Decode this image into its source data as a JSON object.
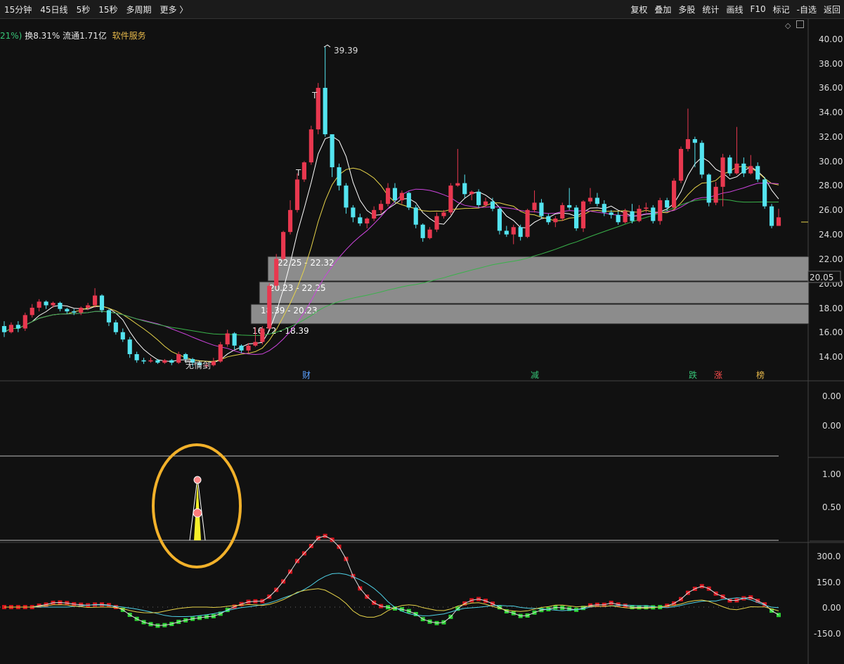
{
  "toolbar": {
    "left": [
      "15分钟",
      "45日线",
      "5秒",
      "15秒",
      "多周期",
      "更多 〉"
    ],
    "right": [
      "复权",
      "叠加",
      "多股",
      "统计",
      "画线",
      "F10",
      "标记",
      "-自选",
      "返回"
    ]
  },
  "info": {
    "pct": "21%)",
    "turnover": "换8.31% 流通1.71亿",
    "service": "软件服务"
  },
  "price_axis": {
    "ticks": [
      "40.00",
      "38.00",
      "36.00",
      "34.00",
      "32.00",
      "30.00",
      "28.00",
      "26.00",
      "24.00",
      "22.00",
      "20.00",
      "18.00",
      "16.00",
      "14.00"
    ],
    "current_price": "20.05"
  },
  "annotations": {
    "high": "39.39",
    "sword": "无情剑",
    "zones": [
      "22.25 - 22.32",
      "20.23 - 22.25",
      "18.39 - 20.23",
      "16.72 - 18.39"
    ]
  },
  "event_marks": [
    {
      "label": "财",
      "color": "#5aa0ff"
    },
    {
      "label": "减",
      "color": "#36c476"
    },
    {
      "label": "跌",
      "color": "#36c476"
    },
    {
      "label": "涨",
      "color": "#ff4d4d"
    },
    {
      "label": "榜",
      "color": "#e6b84a"
    }
  ],
  "panel2": {
    "ticks": [
      "0.00",
      "0.00"
    ]
  },
  "panel3": {
    "ticks": [
      "1.00",
      "0.50"
    ]
  },
  "panel4": {
    "ticks": [
      "300.0",
      "150.0",
      "0.00",
      "-150.0"
    ]
  },
  "colors": {
    "up": "#e8384f",
    "down": "#54e4f0",
    "ma5": "#ffffff",
    "ma10": "#e6d34a",
    "ma20": "#cc44dd",
    "ma60": "#39b24a",
    "highlight": "#f2b12a"
  },
  "chart_data": {
    "type": "candlestick",
    "x_period": "15分钟",
    "candles": [
      [
        16.5,
        16.0,
        16.9,
        15.6
      ],
      [
        16.0,
        16.6,
        16.8,
        15.9
      ],
      [
        16.6,
        16.3,
        16.9,
        16.0
      ],
      [
        16.3,
        17.4,
        17.6,
        16.1
      ],
      [
        17.4,
        18.0,
        18.3,
        17.2
      ],
      [
        18.0,
        18.5,
        18.7,
        17.7
      ],
      [
        18.5,
        18.2,
        18.6,
        17.9
      ],
      [
        18.2,
        18.4,
        18.5,
        18.0
      ],
      [
        18.4,
        17.9,
        18.5,
        17.7
      ],
      [
        17.9,
        17.7,
        18.0,
        17.5
      ],
      [
        17.7,
        17.6,
        17.9,
        17.4
      ],
      [
        17.6,
        18.0,
        18.1,
        17.4
      ],
      [
        18.0,
        18.2,
        18.4,
        17.8
      ],
      [
        18.2,
        19.0,
        19.6,
        18.0
      ],
      [
        19.0,
        17.8,
        19.1,
        17.6
      ],
      [
        17.8,
        16.8,
        17.9,
        16.5
      ],
      [
        16.8,
        16.0,
        17.0,
        15.8
      ],
      [
        16.0,
        15.4,
        16.3,
        15.2
      ],
      [
        15.4,
        14.2,
        15.6,
        13.9
      ],
      [
        14.2,
        13.7,
        14.4,
        13.5
      ],
      [
        13.7,
        13.6,
        13.9,
        13.4
      ],
      [
        13.6,
        13.7,
        13.9,
        13.5
      ],
      [
        13.7,
        13.5,
        13.8,
        13.4
      ],
      [
        13.5,
        13.7,
        13.8,
        13.4
      ],
      [
        13.7,
        13.5,
        13.8,
        13.3
      ],
      [
        13.5,
        14.2,
        14.4,
        13.4
      ],
      [
        14.2,
        13.8,
        14.3,
        13.5
      ],
      [
        13.8,
        13.5,
        13.9,
        13.2
      ],
      [
        13.5,
        13.3,
        13.6,
        13.1
      ],
      [
        13.3,
        13.3,
        13.5,
        13.1
      ],
      [
        13.3,
        13.6,
        13.9,
        13.2
      ],
      [
        13.6,
        15.0,
        15.2,
        13.5
      ],
      [
        15.0,
        15.9,
        16.2,
        14.8
      ],
      [
        15.9,
        14.9,
        16.0,
        14.6
      ],
      [
        14.9,
        14.5,
        15.0,
        14.3
      ],
      [
        14.5,
        14.9,
        15.1,
        14.3
      ],
      [
        14.9,
        15.2,
        16.4,
        14.8
      ],
      [
        15.2,
        16.3,
        16.5,
        15.0
      ],
      [
        16.3,
        19.8,
        20.0,
        16.2
      ],
      [
        19.8,
        22.0,
        22.4,
        19.5
      ],
      [
        22.0,
        24.2,
        24.3,
        21.9
      ],
      [
        24.2,
        26.0,
        26.8,
        24.0
      ],
      [
        26.0,
        28.5,
        29.0,
        25.8
      ],
      [
        28.5,
        29.9,
        30.0,
        28.3
      ],
      [
        29.9,
        32.6,
        32.9,
        29.7
      ],
      [
        32.6,
        36.0,
        36.4,
        32.2
      ],
      [
        36.0,
        32.2,
        39.39,
        32.0
      ],
      [
        32.2,
        29.5,
        31.1,
        28.7
      ],
      [
        29.5,
        28.0,
        29.8,
        27.6
      ],
      [
        28.0,
        26.2,
        28.2,
        25.7
      ],
      [
        26.2,
        25.4,
        26.4,
        25.0
      ],
      [
        25.4,
        24.9,
        25.7,
        24.7
      ],
      [
        24.9,
        25.3,
        25.4,
        24.5
      ],
      [
        25.3,
        26.0,
        26.3,
        25.1
      ],
      [
        26.0,
        26.5,
        26.8,
        25.7
      ],
      [
        26.5,
        27.8,
        28.2,
        26.3
      ],
      [
        27.8,
        26.8,
        28.2,
        26.6
      ],
      [
        26.8,
        27.4,
        27.6,
        26.5
      ],
      [
        27.4,
        26.2,
        27.5,
        26.0
      ],
      [
        26.2,
        24.8,
        26.4,
        24.5
      ],
      [
        24.8,
        23.7,
        24.9,
        23.4
      ],
      [
        23.7,
        24.4,
        24.6,
        23.6
      ],
      [
        24.4,
        25.5,
        25.8,
        24.2
      ],
      [
        25.5,
        25.8,
        26.0,
        25.3
      ],
      [
        25.8,
        28.0,
        28.2,
        25.6
      ],
      [
        28.0,
        28.2,
        31.0,
        27.9
      ],
      [
        28.2,
        27.3,
        28.9,
        27.0
      ],
      [
        27.3,
        27.5,
        27.6,
        26.8
      ],
      [
        27.5,
        26.4,
        27.7,
        26.2
      ],
      [
        26.4,
        26.7,
        27.0,
        26.2
      ],
      [
        26.7,
        26.1,
        27.0,
        25.9
      ],
      [
        26.1,
        24.3,
        26.2,
        24.0
      ],
      [
        24.3,
        24.0,
        24.7,
        23.8
      ],
      [
        24.0,
        24.6,
        24.8,
        23.2
      ],
      [
        24.6,
        23.8,
        24.8,
        23.5
      ],
      [
        23.8,
        26.0,
        26.1,
        23.7
      ],
      [
        26.0,
        26.6,
        27.6,
        25.8
      ],
      [
        26.6,
        25.5,
        26.9,
        25.3
      ],
      [
        25.5,
        25.0,
        25.7,
        24.8
      ],
      [
        25.0,
        25.3,
        25.5,
        24.6
      ],
      [
        25.3,
        26.4,
        26.6,
        25.1
      ],
      [
        26.4,
        26.2,
        27.8,
        26.0
      ],
      [
        26.2,
        24.5,
        26.4,
        24.3
      ],
      [
        24.5,
        26.7,
        26.8,
        24.2
      ],
      [
        26.7,
        27.0,
        27.8,
        26.5
      ],
      [
        27.0,
        26.5,
        27.4,
        26.3
      ],
      [
        26.5,
        25.8,
        26.8,
        25.5
      ],
      [
        25.8,
        25.6,
        26.0,
        25.3
      ],
      [
        25.6,
        25.0,
        25.9,
        24.8
      ],
      [
        25.0,
        25.9,
        26.1,
        24.9
      ],
      [
        25.9,
        25.1,
        26.5,
        24.9
      ],
      [
        25.1,
        26.1,
        26.4,
        25.0
      ],
      [
        26.1,
        26.2,
        26.6,
        25.8
      ],
      [
        26.2,
        25.1,
        26.4,
        24.9
      ],
      [
        25.1,
        26.8,
        27.0,
        24.8
      ],
      [
        26.8,
        26.2,
        27.0,
        25.9
      ],
      [
        26.2,
        28.4,
        28.6,
        26.0
      ],
      [
        28.4,
        31.0,
        31.2,
        28.2
      ],
      [
        31.0,
        31.8,
        34.3,
        30.8
      ],
      [
        31.8,
        31.5,
        32.0,
        29.5
      ],
      [
        31.5,
        28.9,
        31.7,
        28.6
      ],
      [
        28.9,
        26.6,
        29.0,
        26.3
      ],
      [
        26.6,
        27.9,
        28.3,
        26.4
      ],
      [
        27.9,
        30.3,
        30.6,
        26.3
      ],
      [
        30.3,
        29.0,
        30.5,
        28.8
      ],
      [
        29.0,
        29.8,
        32.8,
        28.9
      ],
      [
        29.8,
        29.0,
        30.3,
        28.7
      ],
      [
        29.0,
        29.6,
        30.5,
        28.9
      ],
      [
        29.6,
        28.5,
        29.9,
        28.3
      ],
      [
        28.5,
        26.3,
        28.7,
        26.1
      ],
      [
        26.3,
        24.7,
        26.5,
        24.5
      ],
      [
        24.7,
        25.4,
        26.1,
        24.9
      ]
    ]
  }
}
